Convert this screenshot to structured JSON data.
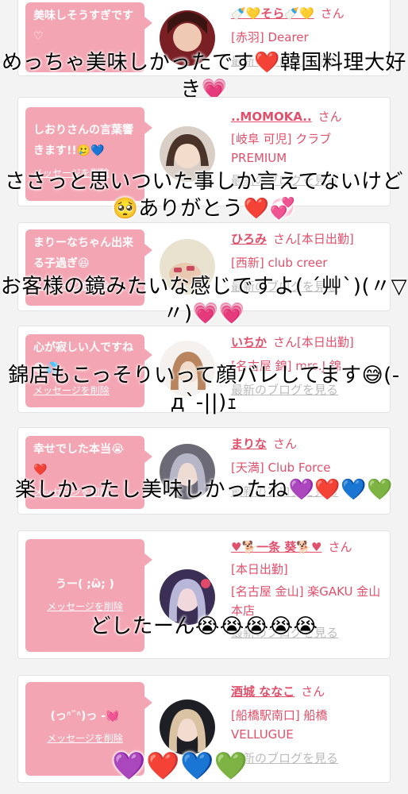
{
  "entries": [
    {
      "message": "美味しそうすぎです♡",
      "delete_label": "メッセージを削除",
      "name": "🍼💛そら🍼💛",
      "honorific": "さん",
      "status": "",
      "shop": "[赤羽] Dearer",
      "blog": "最新のブログを見る",
      "overlay": "めっちゃ美味しかったです❤️韓国料理大好き💗"
    },
    {
      "message": "しおりさんの言葉響きます!!🥲💙",
      "delete_label": "メッセージを削除",
      "name": "..MOMOKA..",
      "honorific": "さん",
      "status": "",
      "shop": "[岐阜 可児] クラブ PREMIUM",
      "blog": "最新のブログを見る",
      "overlay": "ささっと思いついた事しか言えてないけど🥺ありがとう❤️💞"
    },
    {
      "message": "まりーなちゃん出来る子過ぎ😆",
      "delete_label": "メッセージを削除",
      "name": "ひろみ",
      "honorific": "さん",
      "status": "[本日出勤]",
      "shop": "[西新] club creer",
      "blog": "最新のブログを見る",
      "overlay": "お客様の鏡みたいな感じですよ( ´艸`)(〃▽〃)💗💗"
    },
    {
      "message": "心が寂しい人ですね😨💦",
      "delete_label": "メッセージを削除",
      "name": "いちか",
      "honorific": "さん",
      "status": "[本日出勤]",
      "shop": "[名古屋 錦] mrs.J 錦",
      "blog": "最新のブログを見る",
      "overlay": "錦店もこっそりいって顔バレしてます😅(-д`-||)ｪ"
    },
    {
      "message": "幸せでした本当😭❤️",
      "delete_label": "メッセージを削除",
      "name": "まりな",
      "honorific": "さん",
      "status": "",
      "shop": "[天満] Club Force",
      "blog": "最新のブログを見る",
      "overlay": "楽しかったし美味しかったね💜❤️💙💚"
    },
    {
      "message": "うー( ;ὢ; )",
      "delete_label": "メッセージを削除",
      "name": "♥🐕一条 葵🐕♥",
      "honorific": "さん",
      "status": "[本日出勤]",
      "shop": "[名古屋 金山] 楽GAKU 金山本店",
      "blog": "最新のブログを見る",
      "overlay": "どしたーん😭😭😭😭😭"
    },
    {
      "message": "(っᐢ¨ᐢ)っ -💓",
      "delete_label": "メッセージを削除",
      "name": "酒城 ななこ",
      "honorific": "さん",
      "status": "",
      "shop": "[船橋駅南口] 船橋 VELLUGUE",
      "blog": "最新のブログを見る",
      "overlay": "💜❤️💙💚"
    }
  ]
}
